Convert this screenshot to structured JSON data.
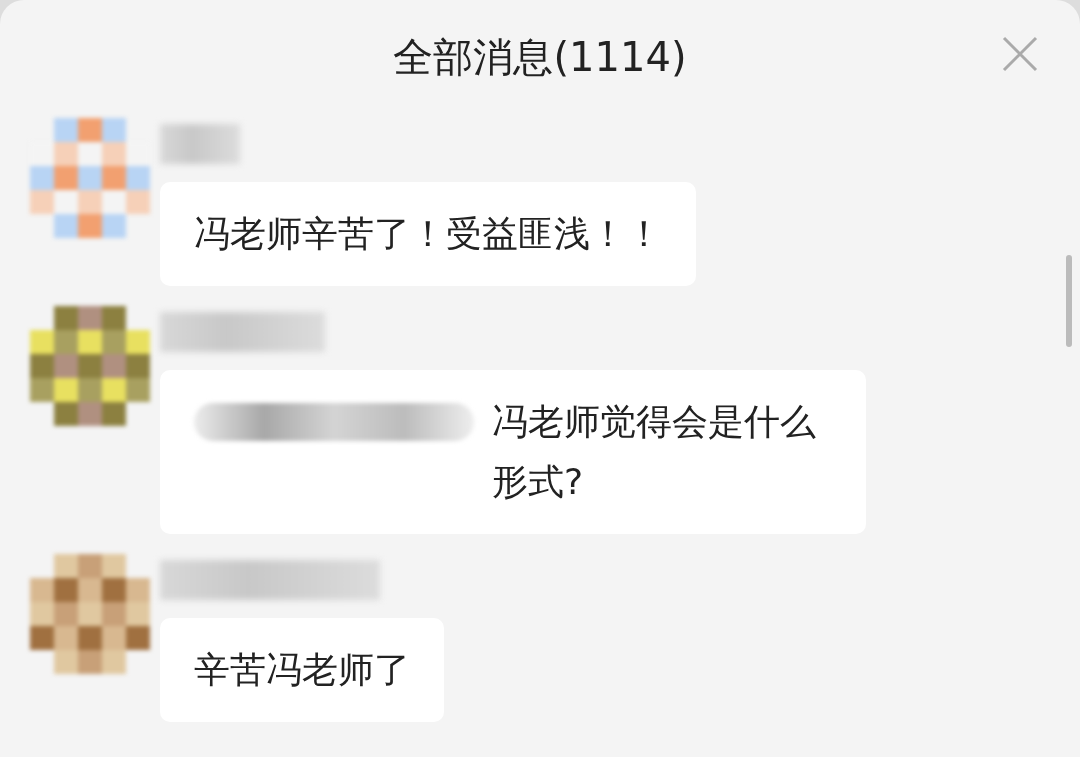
{
  "title": "全部消息(1114)",
  "messages": [
    {
      "text": "冯老师辛苦了！受益匪浅！！",
      "mention": false
    },
    {
      "text": "冯老师觉得会是什么形式?",
      "mention": true
    },
    {
      "text": "辛苦冯老师了",
      "mention": false
    }
  ]
}
